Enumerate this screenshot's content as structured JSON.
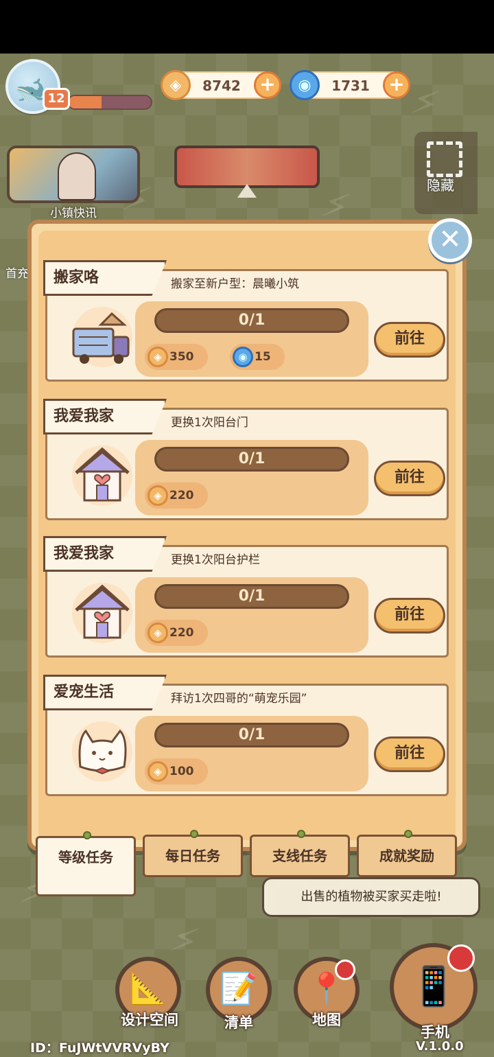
{
  "hud": {
    "level": "12",
    "exp_progress": 0.4,
    "coins": "8742",
    "gems": "1731",
    "plus": "+"
  },
  "left_panel": {
    "news_label": "小镇快讯",
    "side_text_1": "首充"
  },
  "right_panel": {
    "hide_label": "隐藏"
  },
  "tasks": [
    {
      "title": "搬家咯",
      "desc": "搬家至新户型：晨曦小筑",
      "progress": "0/1",
      "icon": "moving-truck-icon",
      "rewards": [
        {
          "type": "coin",
          "value": "350"
        },
        {
          "type": "gem",
          "value": "15"
        }
      ],
      "button": "前往"
    },
    {
      "title": "我爱我家",
      "desc": "更换1次阳台门",
      "progress": "0/1",
      "icon": "house-heart-icon",
      "rewards": [
        {
          "type": "coin",
          "value": "220"
        }
      ],
      "button": "前往"
    },
    {
      "title": "我爱我家",
      "desc": "更换1次阳台护栏",
      "progress": "0/1",
      "icon": "house-heart-icon",
      "rewards": [
        {
          "type": "coin",
          "value": "220"
        }
      ],
      "button": "前往"
    },
    {
      "title": "爱宠生活",
      "desc": "拜访1次四哥的“萌宠乐园”",
      "progress": "0/1",
      "icon": "cat-icon",
      "rewards": [
        {
          "type": "coin",
          "value": "100"
        }
      ],
      "button": "前往"
    }
  ],
  "tabs": [
    {
      "label": "等级任务",
      "active": true
    },
    {
      "label": "每日任务",
      "active": false
    },
    {
      "label": "支线任务",
      "active": false
    },
    {
      "label": "成就奖励",
      "active": false
    }
  ],
  "toast": "出售的植物被买家买走啦!",
  "nav": {
    "design": "设计空间",
    "list": "清单",
    "map": "地图",
    "phone": "手机"
  },
  "footer": {
    "id": "ID：FuJWtVVRVyBY",
    "version": "V.1.0.0"
  },
  "colors": {
    "panel_bg": "#f6d9a4",
    "panel_border": "#b88450",
    "progress_track": "#8d6340",
    "button": "#f4c06e",
    "scene_bg": "#7b7d56"
  }
}
